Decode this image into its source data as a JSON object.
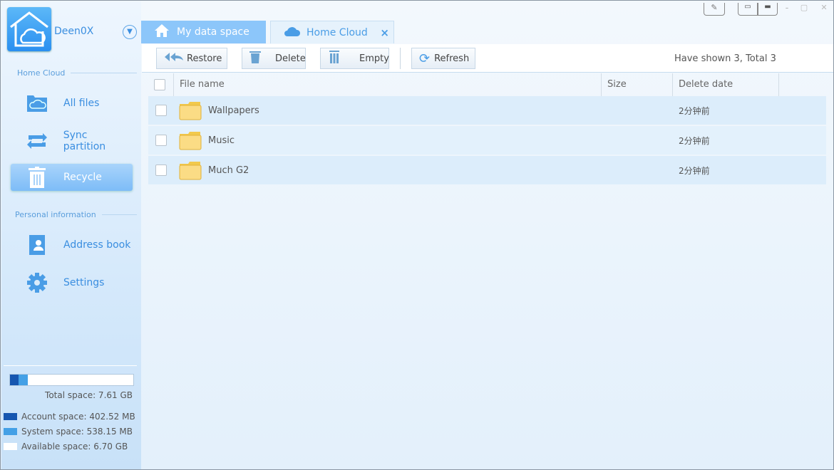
{
  "window": {
    "controls": [
      "pin-icon",
      "mini-mode-icon",
      "compact-mode-icon",
      "minimize-icon",
      "maximize-icon",
      "close-icon"
    ]
  },
  "user": {
    "name": "Deen0X"
  },
  "tabs": [
    {
      "label": "My data space",
      "icon": "home-icon"
    },
    {
      "label": "Home Cloud",
      "icon": "cloud-icon",
      "close": "×"
    }
  ],
  "sidebar": {
    "sections": [
      {
        "label": "Home Cloud"
      },
      {
        "label": "Personal information"
      }
    ],
    "items": [
      {
        "label": "All files",
        "icon": "cloud-folder-icon"
      },
      {
        "label": "Sync partition",
        "icon": "sync-icon"
      },
      {
        "label": "Recycle",
        "icon": "trash-icon",
        "active": true
      },
      {
        "label": "Address book",
        "icon": "address-book-icon"
      },
      {
        "label": "Settings",
        "icon": "gear-icon"
      }
    ]
  },
  "storage": {
    "total": "Total space: 7.61 GB",
    "account": "Account space: 402.52 MB",
    "system": "System space: 538.15 MB",
    "available": "Available space: 6.70 GB",
    "bar_percent": {
      "account": 7,
      "system": 7.5
    },
    "colors": {
      "account": "#1656b0",
      "system": "#44a0e6",
      "available": "#ffffff"
    }
  },
  "toolbar": {
    "restore": "Restore",
    "delete": "Delete",
    "empty": "Empty",
    "refresh": "Refresh",
    "status": "Have shown 3, Total 3"
  },
  "table": {
    "columns": [
      "File name",
      "Size",
      "Delete date"
    ],
    "rows": [
      {
        "name": "Wallpapers",
        "size": "",
        "date": "2分钟前"
      },
      {
        "name": "Music",
        "size": "",
        "date": "2分钟前"
      },
      {
        "name": "Much G2",
        "size": "",
        "date": "2分钟前"
      }
    ]
  }
}
